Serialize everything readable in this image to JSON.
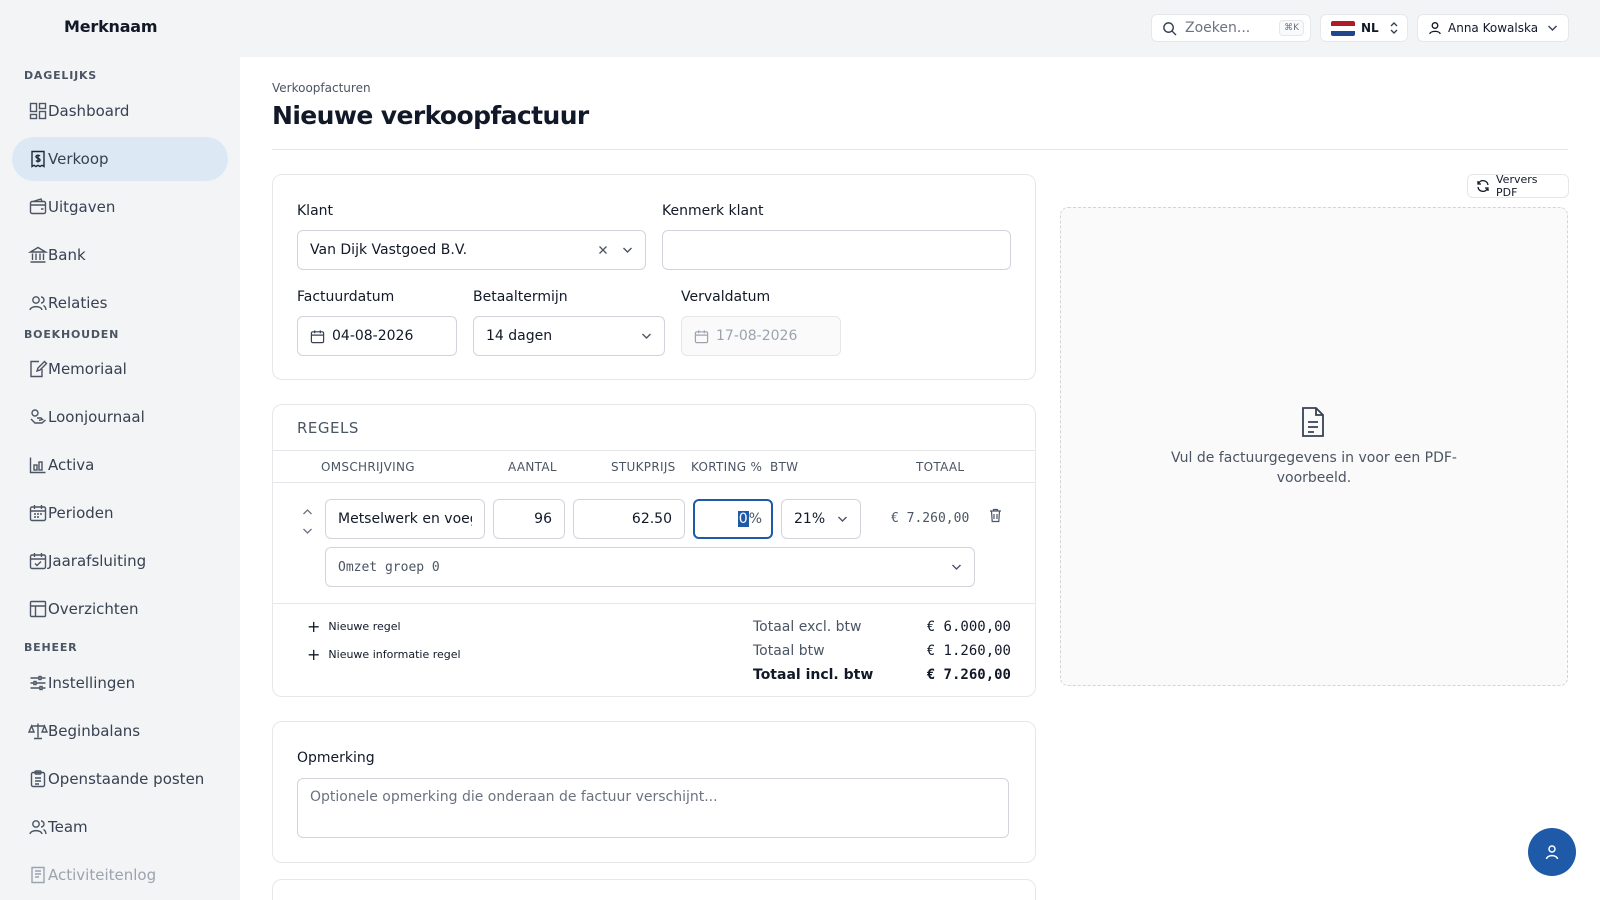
{
  "brand": "Merknaam",
  "topbar": {
    "search_placeholder": "Zoeken...",
    "search_shortcut": "⌘K",
    "language": "NL",
    "user_name": "Anna Kowalska"
  },
  "sidebar": {
    "sections": [
      {
        "title": "DAGELIJKS"
      },
      {
        "title": "BOEKHOUDEN"
      },
      {
        "title": "BEHEER"
      }
    ],
    "items": [
      {
        "label": "Dashboard",
        "icon": "dashboard-icon"
      },
      {
        "label": "Verkoop",
        "icon": "invoice-icon",
        "active": true
      },
      {
        "label": "Uitgaven",
        "icon": "wallet-icon"
      },
      {
        "label": "Bank",
        "icon": "bank-icon"
      },
      {
        "label": "Relaties",
        "icon": "users-icon"
      },
      {
        "label": "Memoriaal",
        "icon": "journal-edit-icon"
      },
      {
        "label": "Loonjournaal",
        "icon": "payroll-icon"
      },
      {
        "label": "Activa",
        "icon": "assets-chart-icon"
      },
      {
        "label": "Perioden",
        "icon": "calendar-icon"
      },
      {
        "label": "Jaarafsluiting",
        "icon": "calendar-check-icon"
      },
      {
        "label": "Overzichten",
        "icon": "table-icon"
      },
      {
        "label": "Instellingen",
        "icon": "sliders-icon"
      },
      {
        "label": "Beginbalans",
        "icon": "scale-icon"
      },
      {
        "label": "Openstaande posten",
        "icon": "clipboard-icon"
      },
      {
        "label": "Team",
        "icon": "team-icon"
      },
      {
        "label": "Activiteitenlog",
        "icon": "log-icon"
      }
    ]
  },
  "page": {
    "breadcrumb": "Verkoopfacturen",
    "title": "Nieuwe verkoopfactuur"
  },
  "form": {
    "klant_label": "Klant",
    "klant_value": "Van Dijk Vastgoed B.V.",
    "kenmerk_label": "Kenmerk klant",
    "kenmerk_value": "",
    "factuurdatum_label": "Factuurdatum",
    "factuurdatum_value": "04-08-2026",
    "betaaltermijn_label": "Betaaltermijn",
    "betaaltermijn_value": "14 dagen",
    "vervaldatum_label": "Vervaldatum",
    "vervaldatum_value": "17-08-2026"
  },
  "regels": {
    "title": "REGELS",
    "columns": {
      "omschrijving": "OMSCHRIJVING",
      "aantal": "AANTAL",
      "stukprijs": "STUKPRIJS",
      "korting": "KORTING %",
      "btw": "BTW",
      "totaal": "TOTAAL"
    },
    "lines": [
      {
        "omschrijving": "Metselwerk en voegwerk",
        "aantal": "96",
        "stukprijs": "62.50",
        "korting": "0",
        "korting_suffix": "%",
        "btw": "21%",
        "totaal": "€ 7.260,00",
        "groep": "Omzet groep 0"
      }
    ],
    "add_line": "Nieuwe regel",
    "add_info_line": "Nieuwe informatie regel",
    "totals": {
      "excl_label": "Totaal excl. btw",
      "excl_value": "€ 6.000,00",
      "btw_label": "Totaal btw",
      "btw_value": "€ 1.260,00",
      "incl_label": "Totaal incl. btw",
      "incl_value": "€ 7.260,00"
    }
  },
  "opmerking": {
    "label": "Opmerking",
    "placeholder": "Optionele opmerking die onderaan de factuur verschijnt..."
  },
  "preview": {
    "refresh_label": "Ververs PDF",
    "empty_text_line1": "Vul de factuurgegevens in voor een PDF-",
    "empty_text_line2": "voorbeeld."
  },
  "colors": {
    "accent": "#1e5aa8",
    "active_nav_bg": "#dde8f5",
    "sidebar_bg": "#f3f4f6",
    "focus_border": "#1e5aa8"
  }
}
